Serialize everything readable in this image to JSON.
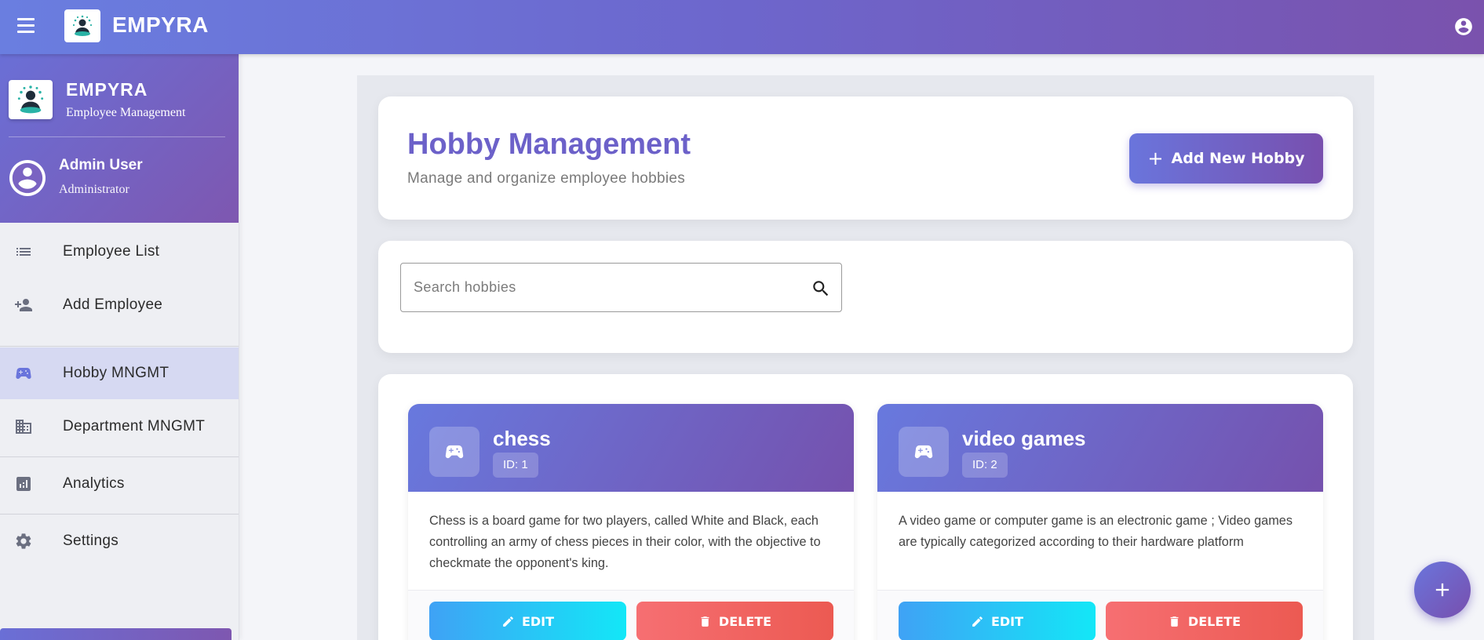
{
  "app": {
    "title": "EMPYRA"
  },
  "sidebar": {
    "brand": "EMPYRA",
    "subtitle": "Employee Management",
    "user": {
      "name": "Admin User",
      "role": "Administrator"
    },
    "items": [
      {
        "label": "Employee List",
        "icon": "list-icon"
      },
      {
        "label": "Add Employee",
        "icon": "person-add-icon"
      },
      {
        "label": "Hobby MNGMT",
        "icon": "gamepad-icon",
        "active": true
      },
      {
        "label": "Department MNGMT",
        "icon": "building-icon"
      },
      {
        "label": "Analytics",
        "icon": "analytics-icon"
      },
      {
        "label": "Settings",
        "icon": "gear-icon"
      }
    ]
  },
  "header": {
    "title": "Hobby Management",
    "subtitle": "Manage and organize employee hobbies",
    "add_button_label": "Add New Hobby"
  },
  "search": {
    "placeholder": "Search hobbies",
    "value": ""
  },
  "hobbies": [
    {
      "name": "chess",
      "id_label": "ID: 1",
      "description": "Chess is a board game for two players, called White and Black, each controlling an army of chess pieces in their color, with the objective to checkmate the opponent's king.",
      "edit_label": "EDIT",
      "delete_label": "DELETE"
    },
    {
      "name": "video games",
      "id_label": "ID: 2",
      "description": "A video game or computer game is an electronic game ; Video games are typically categorized according to their hardware platform",
      "edit_label": "EDIT",
      "delete_label": "DELETE"
    }
  ],
  "colors": {
    "primary": "#6c61c9",
    "edit": "#13e7f7",
    "delete": "#ec5a52"
  }
}
